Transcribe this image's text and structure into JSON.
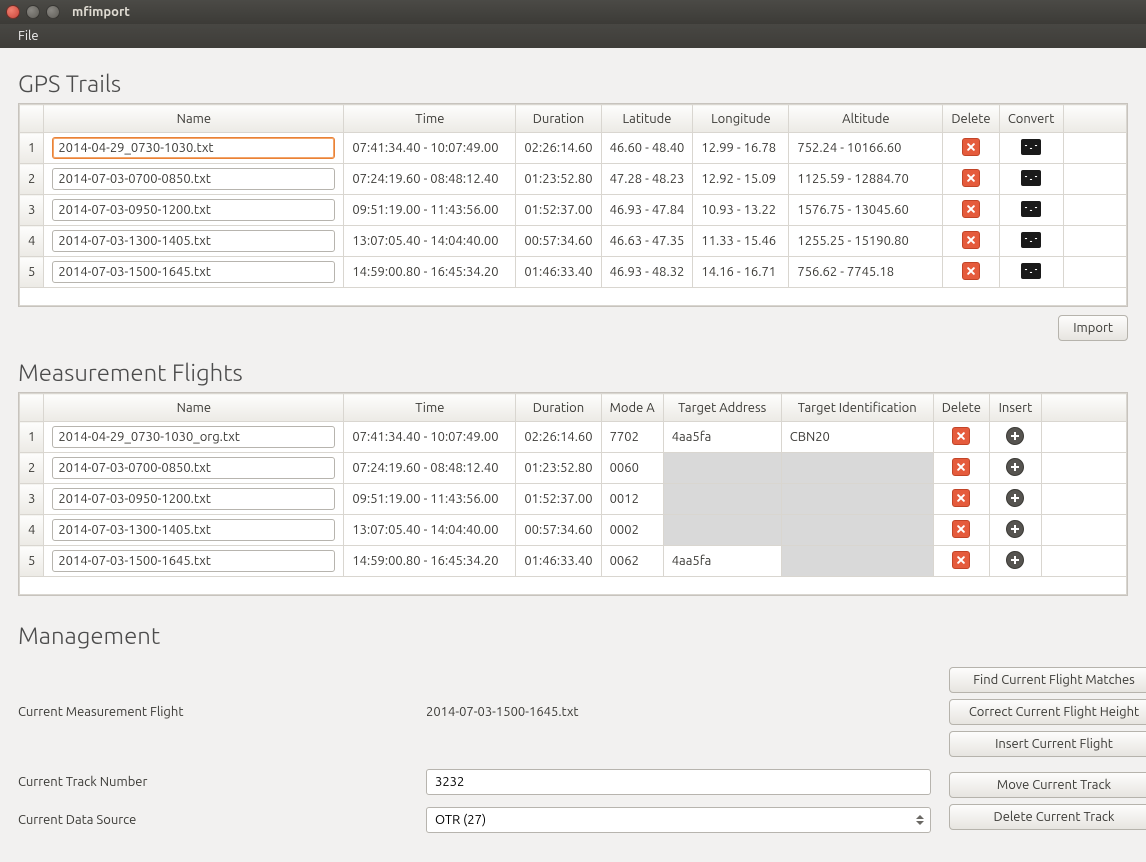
{
  "window": {
    "title": "mfimport"
  },
  "menubar": {
    "file": "File"
  },
  "sections": {
    "gps": "GPS Trails",
    "flights": "Measurement Flights",
    "mgmt": "Management"
  },
  "gps_headers": {
    "name": "Name",
    "time": "Time",
    "duration": "Duration",
    "lat": "Latitude",
    "lon": "Longitude",
    "alt": "Altitude",
    "del": "Delete",
    "conv": "Convert"
  },
  "gps_rows": [
    {
      "n": "1",
      "name": "2014-04-29_0730-1030.txt",
      "time": "07:41:34.40 - 10:07:49.00",
      "dur": "02:26:14.60",
      "lat": "46.60 - 48.40",
      "lon": "12.99 - 16.78",
      "alt": "752.24 - 10166.60"
    },
    {
      "n": "2",
      "name": "2014-07-03-0700-0850.txt",
      "time": "07:24:19.60 - 08:48:12.40",
      "dur": "01:23:52.80",
      "lat": "47.28 - 48.23",
      "lon": "12.92 - 15.09",
      "alt": "1125.59 - 12884.70"
    },
    {
      "n": "3",
      "name": "2014-07-03-0950-1200.txt",
      "time": "09:51:19.00 - 11:43:56.00",
      "dur": "01:52:37.00",
      "lat": "46.93 - 47.84",
      "lon": "10.93 - 13.22",
      "alt": "1576.75 - 13045.60"
    },
    {
      "n": "4",
      "name": "2014-07-03-1300-1405.txt",
      "time": "13:07:05.40 - 14:04:40.00",
      "dur": "00:57:34.60",
      "lat": "46.63 - 47.35",
      "lon": "11.33 - 15.46",
      "alt": "1255.25 - 15190.80"
    },
    {
      "n": "5",
      "name": "2014-07-03-1500-1645.txt",
      "time": "14:59:00.80 - 16:45:34.20",
      "dur": "01:46:33.40",
      "lat": "46.93 - 48.32",
      "lon": "14.16 - 16.71",
      "alt": "756.62 - 7745.18"
    }
  ],
  "import_btn": "Import",
  "flight_headers": {
    "name": "Name",
    "time": "Time",
    "duration": "Duration",
    "modea": "Mode A",
    "target": "Target Address",
    "ident": "Target Identification",
    "del": "Delete",
    "ins": "Insert"
  },
  "flight_rows": [
    {
      "n": "1",
      "name": "2014-04-29_0730-1030_org.txt",
      "time": "07:41:34.40 - 10:07:49.00",
      "dur": "02:26:14.60",
      "modea": "7702",
      "target": "4aa5fa",
      "ident": "CBN20",
      "tg": false,
      "ig": false
    },
    {
      "n": "2",
      "name": "2014-07-03-0700-0850.txt",
      "time": "07:24:19.60 - 08:48:12.40",
      "dur": "01:23:52.80",
      "modea": "0060",
      "target": "",
      "ident": "",
      "tg": true,
      "ig": true
    },
    {
      "n": "3",
      "name": "2014-07-03-0950-1200.txt",
      "time": "09:51:19.00 - 11:43:56.00",
      "dur": "01:52:37.00",
      "modea": "0012",
      "target": "",
      "ident": "",
      "tg": true,
      "ig": true
    },
    {
      "n": "4",
      "name": "2014-07-03-1300-1405.txt",
      "time": "13:07:05.40 - 14:04:40.00",
      "dur": "00:57:34.60",
      "modea": "0002",
      "target": "",
      "ident": "",
      "tg": true,
      "ig": true
    },
    {
      "n": "5",
      "name": "2014-07-03-1500-1645.txt",
      "time": "14:59:00.80 - 16:45:34.20",
      "dur": "01:46:33.40",
      "modea": "0062",
      "target": "4aa5fa",
      "ident": "",
      "tg": false,
      "ig": true
    }
  ],
  "mgmt": {
    "labels": {
      "cmf": "Current Measurement Flight",
      "ctn": "Current Track Number",
      "cds": "Current Data Source"
    },
    "values": {
      "cmf": "2014-07-03-1500-1645.txt",
      "ctn": "3232",
      "cds": "OTR (27)"
    },
    "buttons": {
      "find": "Find Current Flight Matches",
      "correct": "Correct Current Flight Height",
      "insert": "Insert Current Flight",
      "move": "Move Current Track",
      "delete": "Delete Current Track"
    }
  }
}
